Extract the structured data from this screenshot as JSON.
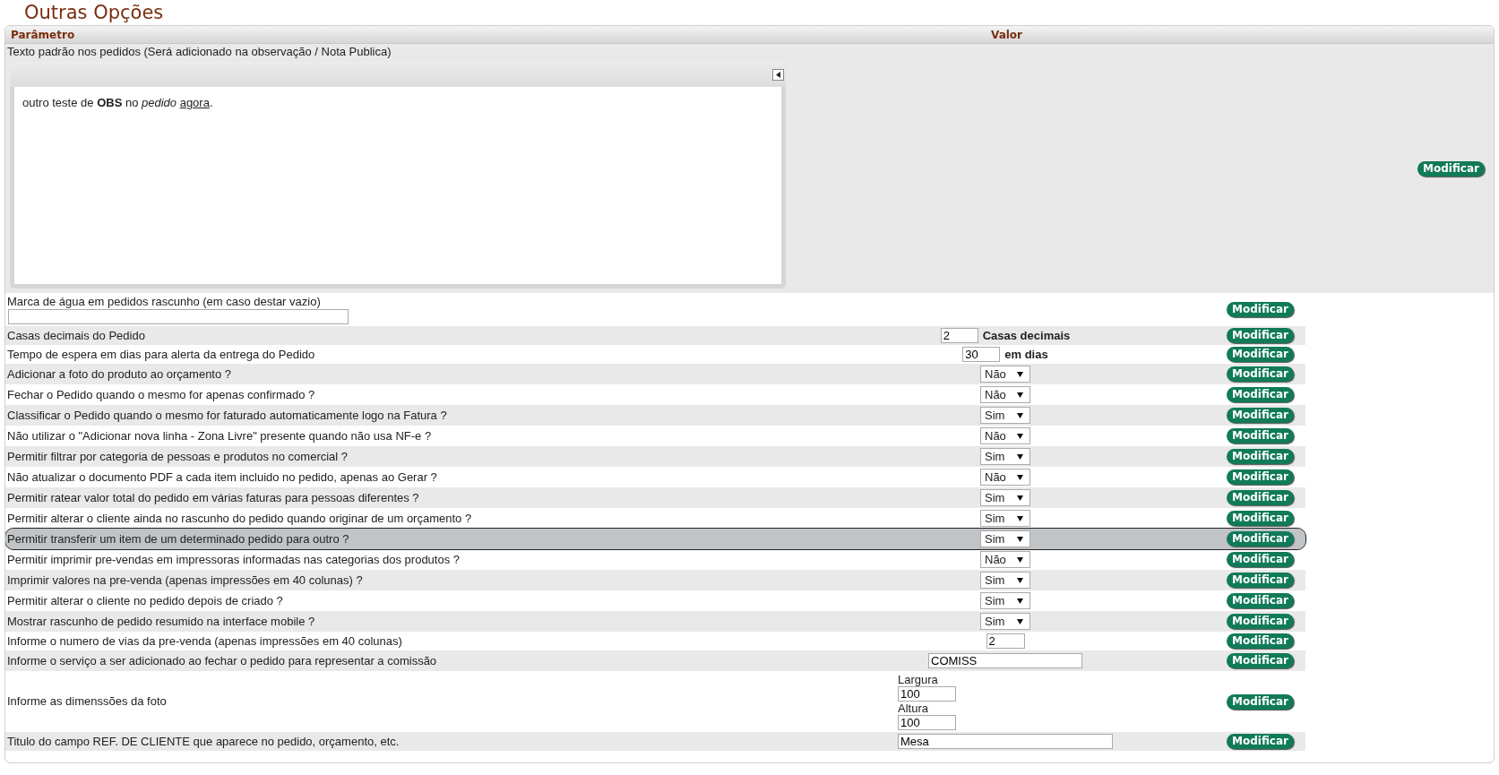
{
  "title": "Outras Opções",
  "table": {
    "columns": [
      "Parâmetro",
      "Valor"
    ],
    "editor_row": {
      "label": "Texto padrão nos pedidos (Será adicionado na observação / Nota Publica)",
      "content": {
        "text": "outro teste de **OBS** no *pedido* ",
        "underlined": "agora",
        "end": "."
      },
      "button": "Modificar"
    },
    "rows": [
      {
        "kind": "stacked_input",
        "label": "Marca de água em pedidos rascunho (em caso destar vazio)",
        "button": "Modificar",
        "highlighted": false
      },
      {
        "kind": "number_unit",
        "label": "Casas decimais do Pedido",
        "value": "2",
        "unit": "Casas decimais",
        "button": "Modificar",
        "highlighted": false
      },
      {
        "kind": "number_unit",
        "label": "Tempo de espera em dias para alerta da entrega do Pedido",
        "value": "30",
        "unit": "em dias",
        "button": "Modificar",
        "highlighted": false
      },
      {
        "kind": "select",
        "label": "Adicionar a foto do produto ao orçamento ?",
        "value": "Não",
        "button": "Modificar",
        "highlighted": false
      },
      {
        "kind": "select",
        "label": "Fechar o Pedido quando o mesmo for apenas confirmado ?",
        "value": "Não",
        "button": "Modificar",
        "highlighted": false
      },
      {
        "kind": "select",
        "label": "Classificar o Pedido quando o mesmo for faturado automaticamente logo na Fatura ?",
        "value": "Sim",
        "button": "Modificar",
        "highlighted": false
      },
      {
        "kind": "select",
        "label": "Não utilizar o \"Adicionar nova linha - Zona Livre\" presente quando não usa NF-e ?",
        "value": "Não",
        "button": "Modificar",
        "highlighted": false
      },
      {
        "kind": "select",
        "label": "Permitir filtrar por categoria de pessoas e produtos no comercial ?",
        "value": "Sim",
        "button": "Modificar",
        "highlighted": false
      },
      {
        "kind": "select",
        "label": "Não atualizar o documento PDF a cada item incluido no pedido, apenas ao Gerar ?",
        "value": "Não",
        "button": "Modificar",
        "highlighted": false
      },
      {
        "kind": "select",
        "label": "Permitir ratear valor total do pedido em várias faturas para pessoas diferentes ?",
        "value": "Sim",
        "button": "Modificar",
        "highlighted": false
      },
      {
        "kind": "select",
        "label": "Permitir alterar o cliente ainda no rascunho do pedido quando originar de um orçamento ?",
        "value": "Sim",
        "button": "Modificar",
        "highlighted": false
      },
      {
        "kind": "select",
        "label": "Permitir transferir um item de um determinado pedido para outro ?",
        "value": "Sim",
        "button": "Modificar",
        "highlighted": true
      },
      {
        "kind": "select",
        "label": "Permitir imprimir pre-vendas em impressoras informadas nas categorias dos produtos ?",
        "value": "Não",
        "button": "Modificar",
        "highlighted": false
      },
      {
        "kind": "select",
        "label": "Imprimir valores na pre-venda (apenas impressões em 40 colunas) ?",
        "value": "Sim",
        "button": "Modificar",
        "highlighted": false
      },
      {
        "kind": "select",
        "label": "Permitir alterar o cliente no pedido depois de criado ?",
        "value": "Sim",
        "button": "Modificar",
        "highlighted": false
      },
      {
        "kind": "select",
        "label": "Mostrar rascunho de pedido resumido na interface mobile ?",
        "value": "Sim",
        "button": "Modificar",
        "highlighted": false
      },
      {
        "kind": "number",
        "label": "Informe o numero de vias da pre-venda (apenas impressões em 40 colunas)",
        "value": "2",
        "button": "Modificar",
        "highlighted": false
      },
      {
        "kind": "text",
        "label": "Informe o serviço a ser adicionado ao fechar o pedido para representar a comissão",
        "value": "COMISS",
        "button": "Modificar",
        "highlighted": false
      },
      {
        "kind": "dimensions",
        "label": "Informe as dimenssões da foto",
        "fields": [
          {
            "label": "Largura",
            "value": "100"
          },
          {
            "label": "Altura",
            "value": "100"
          }
        ],
        "button": "Modificar",
        "highlighted": false
      },
      {
        "kind": "long_text",
        "label": "Titulo do campo REF. DE CLIENTE que aparece no pedido, orçamento, etc.",
        "value": "Mesa",
        "button": "Modificar",
        "highlighted": false
      }
    ]
  }
}
